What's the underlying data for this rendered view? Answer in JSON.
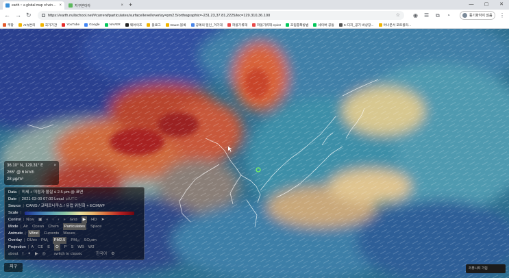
{
  "browser": {
    "tabs": [
      {
        "label": "earth :: a global map of wind, we",
        "color": "#3a8fd8"
      },
      {
        "label": "지구본이아",
        "color": "#5cb85c"
      }
    ],
    "address": "https://earth.nullschool.net/#current/particulates/surface/level/overlay=pm2.5/orthographic=-231.23,37.81,2225/loc=129.310,36.100",
    "profile_label": "동기화하지 않음",
    "bookmarks": [
      {
        "label": "쿠팡",
        "color": "#e35b2c"
      },
      {
        "label": "AI뉴튼리",
        "color": "#f0b400"
      },
      {
        "label": "국가기관",
        "color": "#f0b400"
      },
      {
        "label": "YouTube",
        "color": "#e32b2b"
      },
      {
        "label": "Google",
        "color": "#4285f4"
      },
      {
        "label": "NAVER",
        "color": "#03c75a"
      },
      {
        "label": "웨어이즈",
        "color": "#222222"
      },
      {
        "label": "블로그",
        "color": "#f0b400"
      },
      {
        "label": "Daum 블록",
        "color": "#f0b400"
      },
      {
        "label": "공예의 일인_겨기대",
        "color": "#4a86e8"
      },
      {
        "label": "파울기류재",
        "color": "#e84a4a"
      },
      {
        "label": "파울기류재 epic3",
        "color": "#e84a4a"
      },
      {
        "label": "조립증폭방법",
        "color": "#03c75a"
      },
      {
        "label": "네이버 공동",
        "color": "#03c75a"
      },
      {
        "label": "K-디지_공기 바상장...",
        "color": "#555555"
      },
      {
        "label": "어나운서 포트폴리...",
        "color": "#f0b400"
      }
    ]
  },
  "readout": {
    "coords": "36.10° N, 129.31° E",
    "wind": "265° @ 6  km/h",
    "pm_value": "28",
    "pm_unit": "μg/m³",
    "close": "×"
  },
  "panel": {
    "data": {
      "label": "Data",
      "value": "미세 + 미립자 물질 ≤ 2.5 μm @ 표면"
    },
    "date": {
      "label": "Date",
      "value": "2021-03-09 07:00 Local",
      "suffix": "⇄UTC"
    },
    "source": {
      "label": "Source",
      "value": "CAMS / 코페르니쿠스 / 유럽 위원회 + ECMWF"
    },
    "scale": {
      "label": "Scale"
    },
    "control": {
      "label": "Control",
      "now": "Now",
      "items": [
        "«",
        "‹",
        "›",
        "»"
      ],
      "grid": "Grid",
      "hd": "HD"
    },
    "mode": {
      "label": "Mode",
      "options": [
        "Air",
        "Ocean",
        "Chem",
        "Particulates",
        "Space"
      ],
      "selected": "Particulates"
    },
    "animate": {
      "label": "Animate",
      "options": [
        "Wind",
        "Currents",
        "Waves"
      ],
      "selected": "Wind"
    },
    "overlay": {
      "label": "Overlay",
      "options": [
        "DUex",
        "PM₁",
        "PM2.5",
        "PM₁₀",
        "SO₂sm"
      ],
      "selected": "PM2.5"
    },
    "projection": {
      "label": "Projection",
      "options": [
        "A",
        "CE",
        "E",
        "O",
        "P",
        "S",
        "WB",
        "W3"
      ],
      "selected": "O"
    },
    "footer": {
      "about": "about",
      "switch": "switch to classic",
      "lang": "한국어"
    }
  },
  "earth_button": "지구",
  "toast": {
    "text": "커뮤니티 가입",
    "bold": "가입"
  }
}
